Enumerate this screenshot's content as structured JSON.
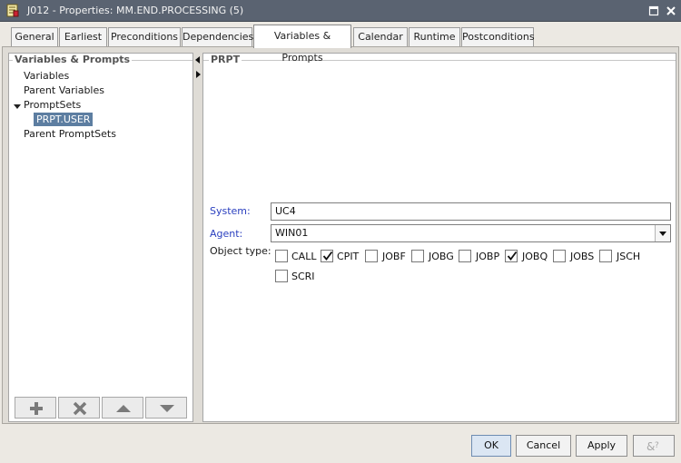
{
  "window": {
    "title": "J012 - Properties: MM.END.PROCESSING (5)",
    "app_icon": "properties-doc-icon",
    "maximize_icon": "maximize-icon",
    "close_icon": "close-icon"
  },
  "tabs": [
    {
      "label": "General",
      "active": false
    },
    {
      "label": "Earliest",
      "active": false
    },
    {
      "label": "Preconditions",
      "active": false
    },
    {
      "label": "Dependencies",
      "active": false
    },
    {
      "label": "Variables & Prompts",
      "active": true
    },
    {
      "label": "Calendar",
      "active": false
    },
    {
      "label": "Runtime",
      "active": false
    },
    {
      "label": "Postconditions",
      "active": false
    }
  ],
  "left_panel": {
    "heading": "Variables & Prompts",
    "tree": [
      {
        "label": "Variables"
      },
      {
        "label": "Parent Variables"
      },
      {
        "label": "PromptSets",
        "expanded": true
      },
      {
        "label": "PRPT.USER",
        "selected": true
      },
      {
        "label": "Parent PromptSets"
      }
    ],
    "toolbar_icons": [
      "add-icon",
      "delete-icon",
      "move-up-icon",
      "move-down-icon"
    ]
  },
  "right_panel": {
    "heading": "PRPT",
    "system_label": "System:",
    "system_value": "UC4",
    "agent_label": "Agent:",
    "agent_value": "WIN01",
    "object_type_label": "Object type:",
    "object_types": [
      {
        "label": "CALL",
        "checked": false
      },
      {
        "label": "CPIT",
        "checked": true
      },
      {
        "label": "JOBF",
        "checked": false
      },
      {
        "label": "JOBG",
        "checked": false
      },
      {
        "label": "JOBP",
        "checked": false
      },
      {
        "label": "JOBQ",
        "checked": true
      },
      {
        "label": "JOBS",
        "checked": false
      },
      {
        "label": "JSCH",
        "checked": false
      },
      {
        "label": "SCRI",
        "checked": false
      }
    ]
  },
  "buttons": {
    "ok": "OK",
    "cancel": "Cancel",
    "apply": "Apply",
    "help_icon": "help-context-icon"
  },
  "colors": {
    "titlebar": "#5a6371",
    "selection": "#5d7ea1",
    "label_blue": "#2a3fbf"
  }
}
